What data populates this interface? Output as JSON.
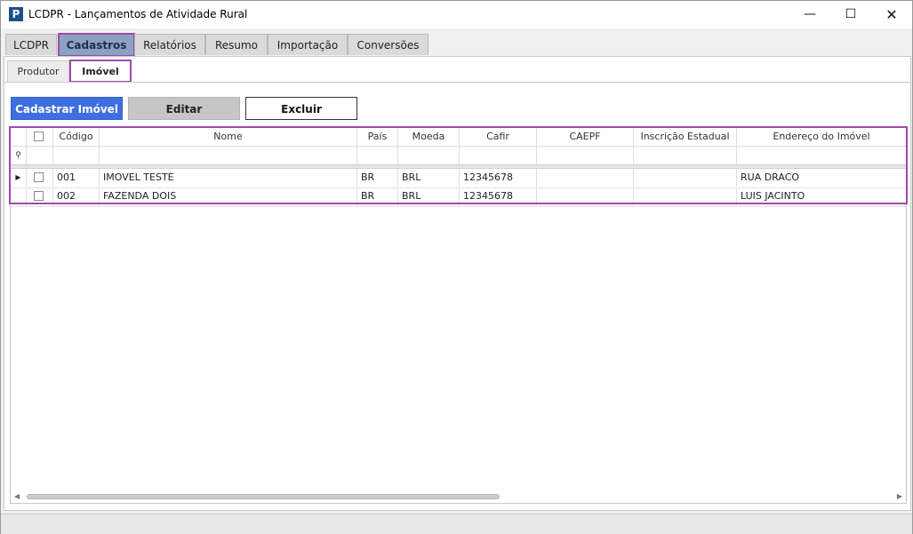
{
  "window": {
    "title": "LCDPR - Lançamentos de Atividade Rural",
    "icon_letter": "P",
    "min_glyph": "—",
    "max_glyph": "☐",
    "close_glyph": "✕"
  },
  "tabs": [
    {
      "label": "LCDPR"
    },
    {
      "label": "Cadastros",
      "active": true
    },
    {
      "label": "Relatórios"
    },
    {
      "label": "Resumo"
    },
    {
      "label": "Importação"
    },
    {
      "label": "Conversões"
    }
  ],
  "subtabs": [
    {
      "label": "Produtor"
    },
    {
      "label": "Imóvel",
      "active": true
    }
  ],
  "toolbar": {
    "register_label": "Cadastrar Imóvel",
    "edit_label": "Editar",
    "delete_label": "Excluir"
  },
  "grid": {
    "columns": [
      "Código",
      "Nome",
      "País",
      "Moeda",
      "Cafir",
      "CAEPF",
      "Inscrição Estadual",
      "Endereço do Imóvel"
    ],
    "rows": [
      {
        "codigo": "001",
        "nome": "IMOVEL TESTE",
        "pais": "BR",
        "moeda": "BRL",
        "cafir": "12345678",
        "caepf": "",
        "inscricao": "",
        "endereco": "RUA DRACO"
      },
      {
        "codigo": "002",
        "nome": "FAZENDA DOIS",
        "pais": "BR",
        "moeda": "BRL",
        "cafir": "12345678",
        "caepf": "",
        "inscricao": "",
        "endereco": "LUIS JACINTO"
      }
    ],
    "current_row_glyph": "▶",
    "filter_glyph": "⚲",
    "scroll_left_glyph": "◀",
    "scroll_right_glyph": "▶"
  },
  "colors": {
    "accent": "#3d6fe0",
    "active_tab": "#8aa2c4",
    "highlight": "#a04aa8"
  }
}
